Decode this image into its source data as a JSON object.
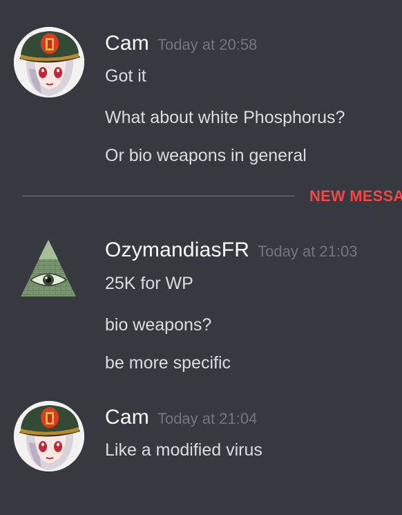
{
  "messages": [
    {
      "username": "Cam",
      "timestamp": "Today at 20:58",
      "lines": [
        "Got it",
        "What about white Phosphorus?",
        "Or bio weapons in general"
      ],
      "avatar_icon": "anime-officer-avatar"
    },
    {
      "username": "OzymandiasFR",
      "timestamp": "Today at 21:03",
      "lines": [
        "25K for WP",
        "bio weapons?",
        "be more specific"
      ],
      "avatar_icon": "illuminati-pyramid-avatar"
    },
    {
      "username": "Cam",
      "timestamp": "Today at 21:04",
      "lines": [
        "Like a modified virus"
      ],
      "avatar_icon": "anime-officer-avatar"
    }
  ],
  "divider": {
    "label": "NEW MESSA"
  },
  "colors": {
    "background": "#36393f",
    "username": "#ffffff",
    "text": "#dcddde",
    "timestamp": "#72767d",
    "new_messages": "#f04747"
  }
}
